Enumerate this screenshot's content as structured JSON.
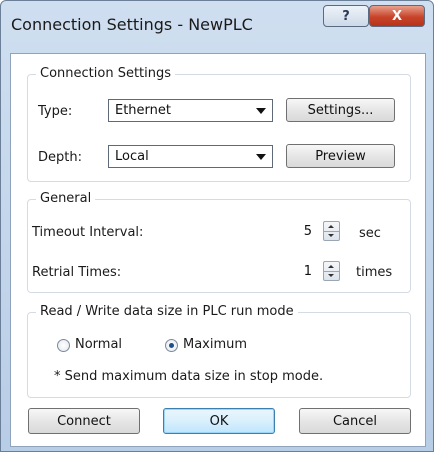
{
  "window": {
    "title": "Connection Settings - NewPLC",
    "help_icon": "?",
    "close_icon": "X"
  },
  "connection": {
    "legend": "Connection Settings",
    "type_label": "Type:",
    "type_value": "Ethernet",
    "settings_button": "Settings...",
    "depth_label": "Depth:",
    "depth_value": "Local",
    "preview_button": "Preview"
  },
  "general": {
    "legend": "General",
    "timeout_label": "Timeout Interval:",
    "timeout_value": "5",
    "timeout_unit": "sec",
    "retrial_label": "Retrial Times:",
    "retrial_value": "1",
    "retrial_unit": "times"
  },
  "readwrite": {
    "legend": "Read / Write data size in PLC run mode",
    "option_normal": "Normal",
    "option_maximum": "Maximum",
    "selected": "Maximum",
    "note": "* Send maximum data size in stop mode."
  },
  "buttons": {
    "connect": "Connect",
    "ok": "OK",
    "cancel": "Cancel"
  }
}
